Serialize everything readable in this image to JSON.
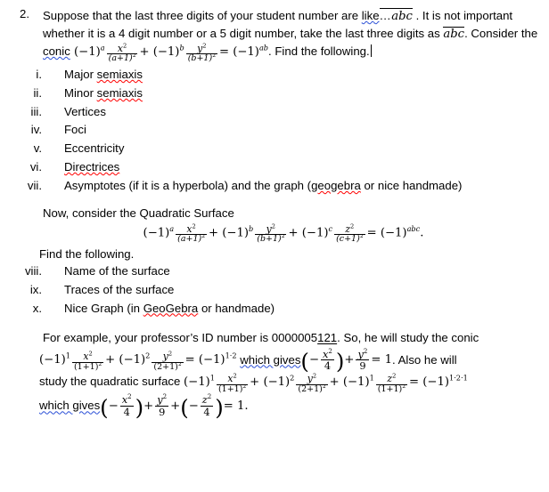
{
  "document": {
    "question_number": "2.",
    "intro": {
      "seg1": "Suppose that the last three digits of your student number are ",
      "word_like": "like",
      "dots": "…",
      "abc_overline": "abc",
      "seg2": " . It is not important whether it is a 4 digit number or a 5 digit number, take the last three digits as ",
      "abc_overline2": "abc",
      "seg3": ". Consider the ",
      "word_conic": "conic",
      "seg4": ". Find the following.",
      "caret_present": true
    },
    "conic_equation": {
      "t1_base": "(−1)",
      "t1_exp": "a",
      "t1_num": "x",
      "t1_num_exp": "2",
      "t1_den": "(a+1)",
      "t1_den_exp": "2",
      "op1": "+",
      "t2_base": "(−1)",
      "t2_exp": "b",
      "t2_num": "y",
      "t2_num_exp": "2",
      "t2_den": "(b+1)",
      "t2_den_exp": "2",
      "eq": "=",
      "rhs_base": "(−1)",
      "rhs_exp": "ab"
    },
    "roman_list_1": [
      {
        "mark": "i.",
        "label": "Major ",
        "label_misspelled": "semiaxis",
        "misspell": true
      },
      {
        "mark": "ii.",
        "label": "Minor ",
        "label_misspelled": "semiaxis",
        "misspell": true
      },
      {
        "mark": "iii.",
        "label": "Vertices",
        "label_misspelled": "",
        "misspell": false
      },
      {
        "mark": "iv.",
        "label": "Foci",
        "label_misspelled": "",
        "misspell": false
      },
      {
        "mark": "v.",
        "label": "Eccentricity",
        "label_misspelled": "",
        "misspell": false
      },
      {
        "mark": "vi.",
        "label": "",
        "label_misspelled": "Directrices",
        "misspell": true
      },
      {
        "mark": "vii.",
        "label": "Asymptotes (if it is a hyperbola) and the graph (",
        "label_misspelled": "geogebra",
        "misspell": true,
        "label_tail": " or nice handmade)"
      }
    ],
    "surface_intro": "Now, consider the Quadratic Surface",
    "surface_equation": {
      "t1_base": "(−1)",
      "t1_exp": "a",
      "t1_num": "x",
      "t1_den": "(a+1)",
      "op1": "+",
      "t2_base": "(−1)",
      "t2_exp": "b",
      "t2_num": "y",
      "t2_den": "(b+1)",
      "op2": "+",
      "t3_base": "(−1)",
      "t3_exp": "c",
      "t3_num": "z",
      "t3_den": "(c+1)",
      "eq": "=",
      "rhs_base": "(−1)",
      "rhs_exp": "abc",
      "period": "."
    },
    "find_following": "Find the following.",
    "roman_list_2": [
      {
        "mark": "viii.",
        "label": "Name of the surface",
        "label_misspelled": "",
        "misspell": false
      },
      {
        "mark": "ix.",
        "label": "Traces of the surface",
        "label_misspelled": "",
        "misspell": false
      },
      {
        "mark": "x.",
        "label": "Nice Graph (in ",
        "label_misspelled": "GeoGebra",
        "misspell": true,
        "label_tail": " or handmade)"
      }
    ],
    "example": {
      "lead": "For example, your professor’s ID number is 0000005",
      "id_highlight": "121",
      "lead_tail": ". So, he will study the conic",
      "conic": {
        "t1_base": "(−1)",
        "t1_exp": "1",
        "t1_num": "x",
        "t1_den": "(1+1)",
        "op1": "+",
        "t2_base": "(−1)",
        "t2_exp": "2",
        "t2_num": "y",
        "t2_den": "(2+1)",
        "eq": "=",
        "rhs_base": "(−1)",
        "rhs_exp": "1·2"
      },
      "which_gives": "which gives",
      "gives_conic": {
        "minus": "−",
        "f1_num": "x",
        "f1_den": "4",
        "op1": "+",
        "f2_num": "y",
        "f2_den": "9",
        "eq": "= 1",
        "tail": ". Also he will"
      },
      "surface_lead": "study the quadratic surface",
      "surface": {
        "t1_base": "(−1)",
        "t1_exp": "1",
        "t1_num": "x",
        "t1_den": "(1+1)",
        "op1": "+",
        "t2_base": "(−1)",
        "t2_exp": "2",
        "t2_num": "y",
        "t2_den": "(2+1)",
        "op2": "+",
        "t3_base": "(−1)",
        "t3_exp": "1",
        "t3_num": "z",
        "t3_den": "(1+1)",
        "eq": "=",
        "rhs_base": "(−1)",
        "rhs_exp": "1·2·1"
      },
      "which_gives2": "which gives",
      "gives_surface": {
        "minus1": "−",
        "f1_num": "x",
        "f1_den": "4",
        "op1": "+",
        "f2_num": "y",
        "f2_den": "9",
        "op2": "+",
        "minus2": "−",
        "f3_num": "z",
        "f3_den": "4",
        "eq": "= 1."
      }
    },
    "superscript_two": "2"
  }
}
